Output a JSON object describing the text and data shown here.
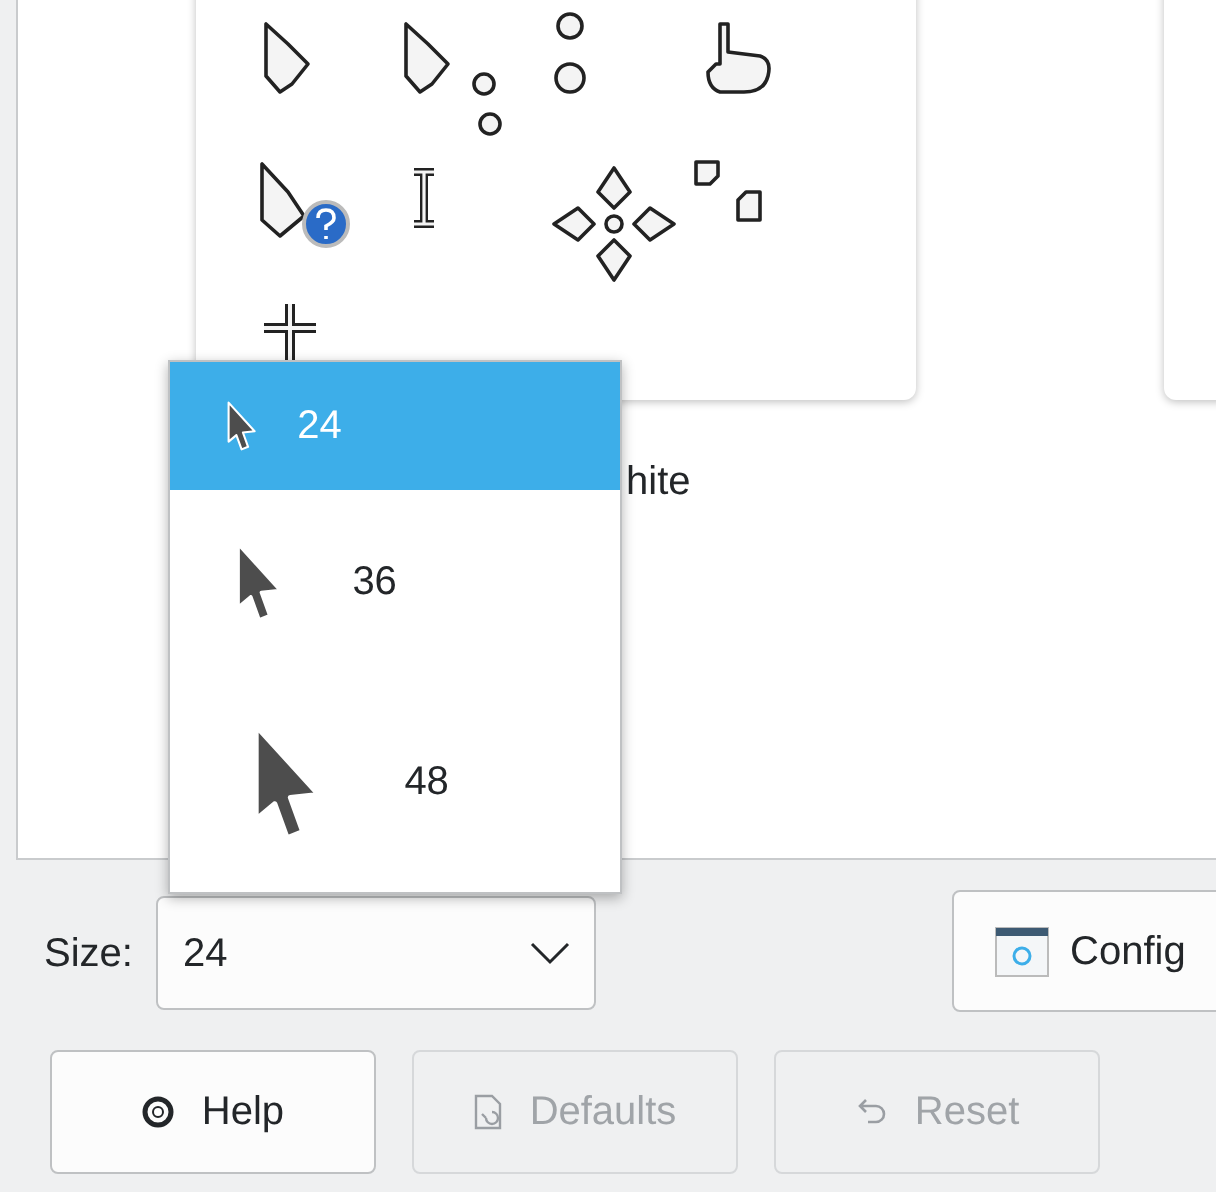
{
  "theme_preview": {
    "caption": "hite"
  },
  "size_dropdown": {
    "options": [
      {
        "label": "24",
        "selected": true,
        "kind": "small"
      },
      {
        "label": "36",
        "selected": false,
        "kind": "medium"
      },
      {
        "label": "48",
        "selected": false,
        "kind": "large"
      }
    ]
  },
  "size_field": {
    "label": "Size:",
    "value": "24"
  },
  "configure_button": {
    "label": "Config"
  },
  "buttons": [
    {
      "label": "Help",
      "disabled": false,
      "kind": "help"
    },
    {
      "label": "Defaults",
      "disabled": true,
      "kind": "defaults"
    },
    {
      "label": "Reset",
      "disabled": true,
      "kind": "reset"
    }
  ]
}
